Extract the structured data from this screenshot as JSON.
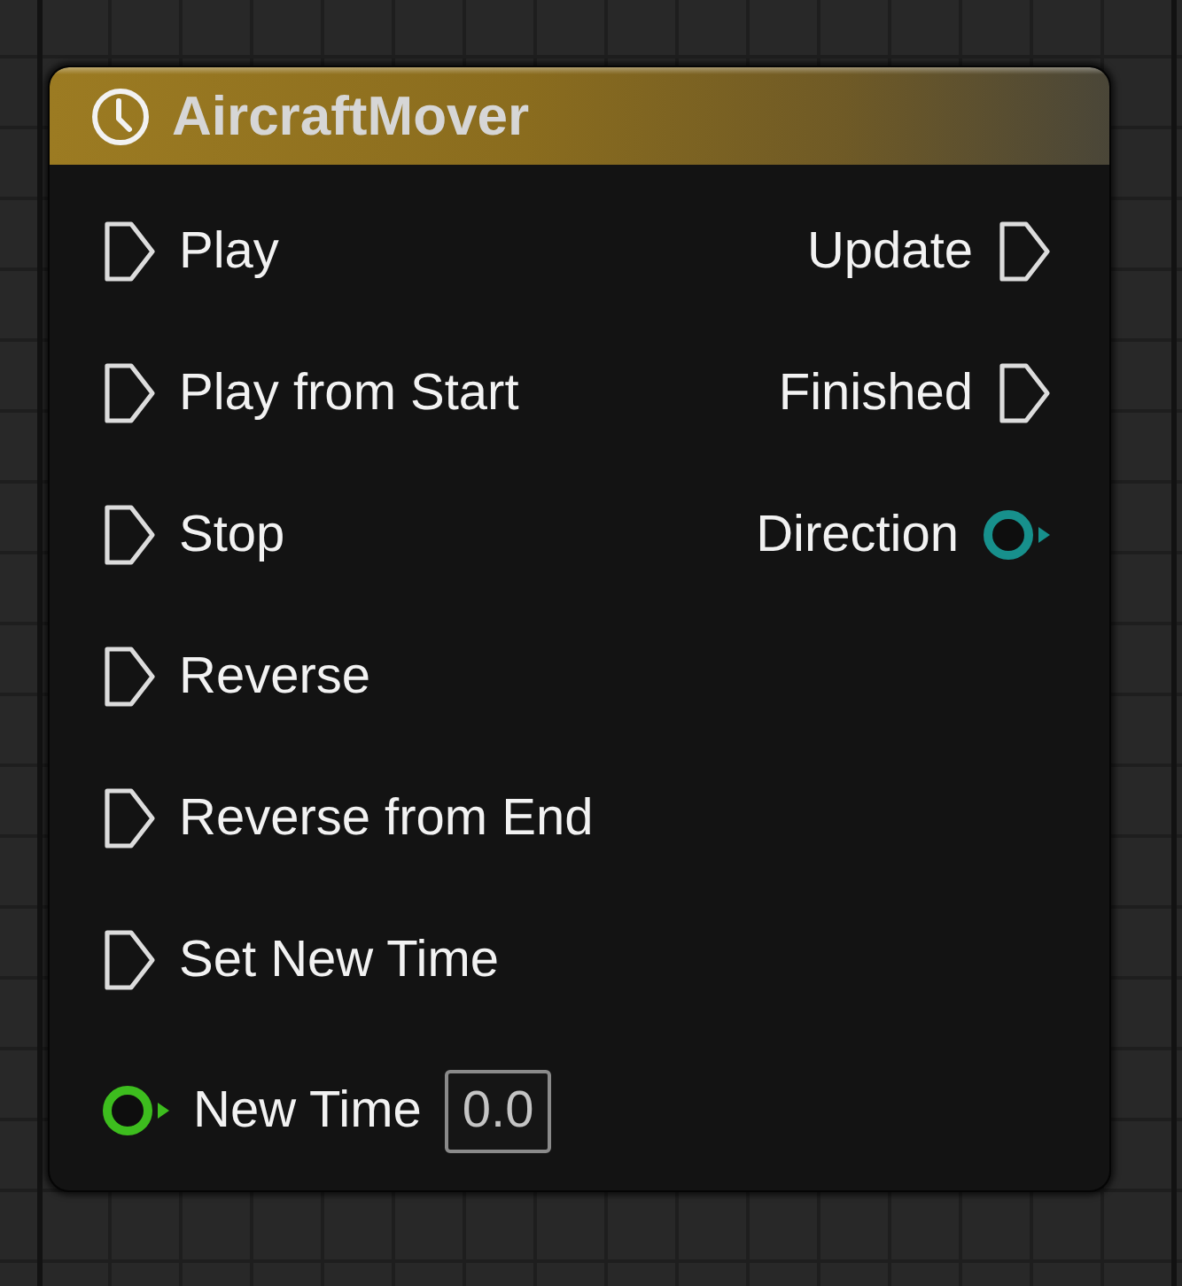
{
  "node": {
    "title": "AircraftMover",
    "inputs": [
      {
        "kind": "exec",
        "label": "Play"
      },
      {
        "kind": "exec",
        "label": "Play from Start"
      },
      {
        "kind": "exec",
        "label": "Stop"
      },
      {
        "kind": "exec",
        "label": "Reverse"
      },
      {
        "kind": "exec",
        "label": "Reverse from End"
      },
      {
        "kind": "exec",
        "label": "Set New Time"
      },
      {
        "kind": "data",
        "label": "New Time",
        "color": "#3dbd1e",
        "value": "0.0"
      }
    ],
    "outputs": [
      {
        "kind": "exec",
        "label": "Update"
      },
      {
        "kind": "exec",
        "label": "Finished"
      },
      {
        "kind": "data",
        "label": "Direction",
        "color": "#17908c"
      }
    ]
  }
}
